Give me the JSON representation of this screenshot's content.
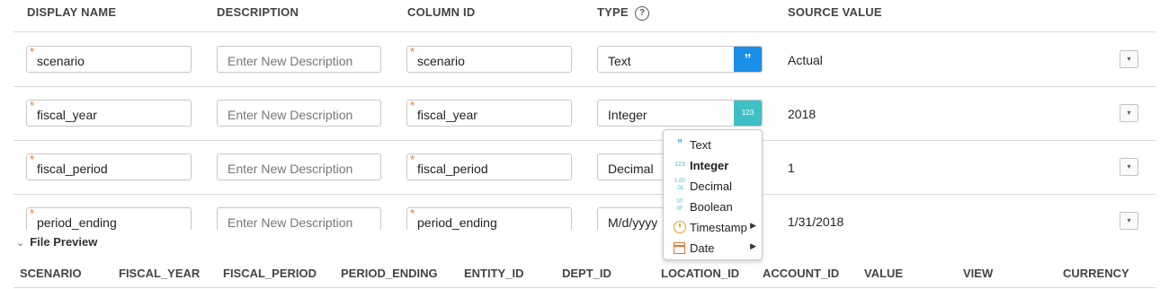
{
  "columns": {
    "display_name": "DISPLAY NAME",
    "description": "DESCRIPTION",
    "column_id": "COLUMN ID",
    "type": "TYPE",
    "source_value": "SOURCE VALUE"
  },
  "help_icon_glyph": "?",
  "required_marker": "*",
  "description_placeholder": "Enter New Description",
  "rows": [
    {
      "display_name": "scenario",
      "column_id": "scenario",
      "type": "Text",
      "type_icon": "”",
      "source_value": "Actual"
    },
    {
      "display_name": "fiscal_year",
      "column_id": "fiscal_year",
      "type": "Integer",
      "type_icon": "123",
      "source_value": "2018"
    },
    {
      "display_name": "fiscal_period",
      "column_id": "fiscal_period",
      "type": "Decimal",
      "source_value": "1"
    },
    {
      "display_name": "period_ending",
      "column_id": "period_ending",
      "type": "M/d/yyyy",
      "source_value": "1/31/2018"
    }
  ],
  "dropdown_glyph": "▾",
  "type_menu": {
    "items": [
      {
        "label": "Text",
        "icon": "quote-icon",
        "glyph": "”"
      },
      {
        "label": "Integer",
        "icon": "integer-icon",
        "glyph": "123",
        "selected": true
      },
      {
        "label": "Decimal",
        "icon": "decimal-icon",
        "glyph_top": "1.00",
        "glyph_bottom": ".01"
      },
      {
        "label": "Boolean",
        "icon": "boolean-icon",
        "glyph_top": "0T",
        "glyph_bottom": "0F"
      },
      {
        "label": "Timestamp",
        "icon": "clock-icon",
        "submenu": true
      },
      {
        "label": "Date",
        "icon": "calendar-icon",
        "submenu": true
      }
    ],
    "submenu_glyph": "▶"
  },
  "file_preview": {
    "title": "File Preview",
    "chevron": "⌄",
    "columns": [
      "SCENARIO",
      "FISCAL_YEAR",
      "FISCAL_PERIOD",
      "PERIOD_ENDING",
      "ENTITY_ID",
      "DEPT_ID",
      "LOCATION_ID",
      "ACCOUNT_ID",
      "VALUE",
      "VIEW",
      "CURRENCY"
    ]
  },
  "colors": {
    "text_type_accent": "#1a8fe8",
    "integer_type_accent": "#3fc0c7",
    "required_marker": "#e8752b"
  }
}
